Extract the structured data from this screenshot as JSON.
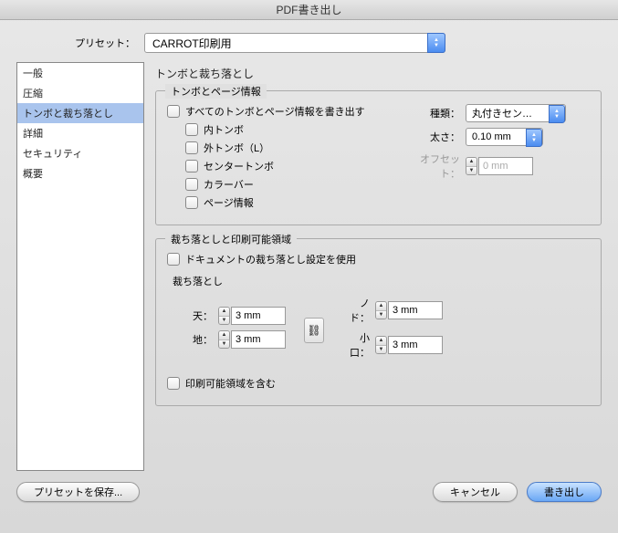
{
  "window": {
    "title": "PDF書き出し"
  },
  "preset": {
    "label": "プリセット：",
    "value": "CARROT印刷用"
  },
  "sidebar": {
    "items": [
      {
        "label": "一般"
      },
      {
        "label": "圧縮"
      },
      {
        "label": "トンボと裁ち落とし"
      },
      {
        "label": "詳細"
      },
      {
        "label": "セキュリティ"
      },
      {
        "label": "概要"
      }
    ],
    "selected_index": 2
  },
  "section": {
    "title": "トンボと裁ち落とし"
  },
  "marks_group": {
    "legend": "トンボとページ情報",
    "all_label": "すべてのトンボとページ情報を書き出す",
    "checks": [
      "内トンボ",
      "外トンボ（L）",
      "センタートンボ",
      "カラーバー",
      "ページ情報"
    ],
    "type_label": "種類：",
    "type_value": "丸付きセン…",
    "weight_label": "太さ：",
    "weight_value": "0.10 mm",
    "offset_label": "オフセット：",
    "offset_value": "0 mm"
  },
  "bleed_group": {
    "legend": "裁ち落としと印刷可能領域",
    "use_doc_bleed": "ドキュメントの裁ち落とし設定を使用",
    "bleed_title": "裁ち落とし",
    "top_label": "天：",
    "bottom_label": "地：",
    "inside_label": "ノド：",
    "outside_label": "小口：",
    "value": "3 mm",
    "include_slug": "印刷可能領域を含む"
  },
  "buttons": {
    "save_preset": "プリセットを保存...",
    "cancel": "キャンセル",
    "export": "書き出し"
  }
}
